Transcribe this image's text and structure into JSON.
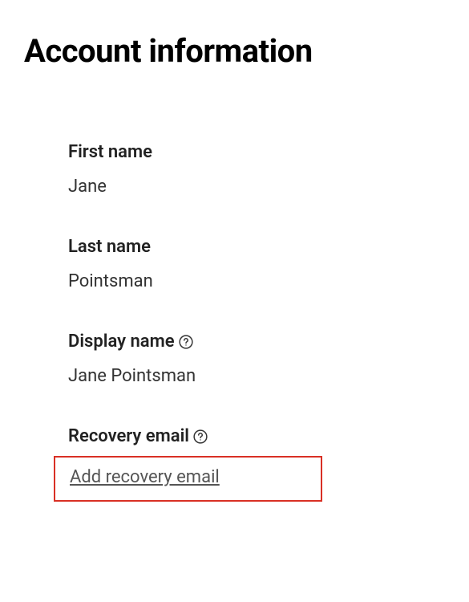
{
  "page": {
    "title": "Account information"
  },
  "fields": {
    "first_name": {
      "label": "First name",
      "value": "Jane"
    },
    "last_name": {
      "label": "Last name",
      "value": "Pointsman"
    },
    "display_name": {
      "label": "Display name",
      "value": "Jane Pointsman"
    },
    "recovery_email": {
      "label": "Recovery email",
      "action_label": "Add recovery email"
    }
  }
}
